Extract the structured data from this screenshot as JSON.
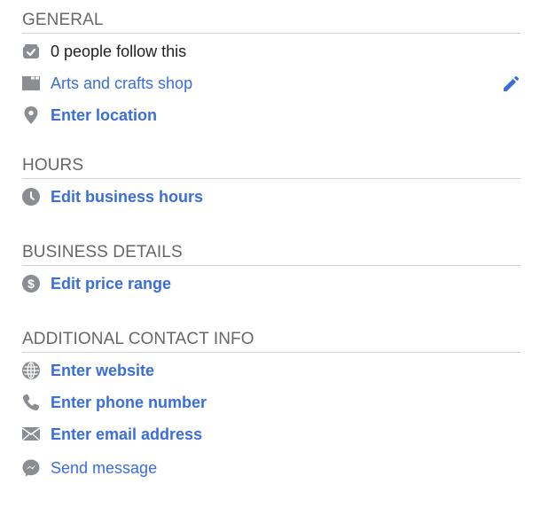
{
  "colors": {
    "accent": "#3a6ed8",
    "icon_gray": "#8a8d91",
    "heading_gray": "#65676b",
    "divider": "#cdd0d4",
    "text_dark": "#1c1e21"
  },
  "sections": {
    "general": {
      "title": "GENERAL",
      "followers": {
        "icon": "followers-check-icon",
        "text": "0 people follow this"
      },
      "category": {
        "icon": "category-icon",
        "text": "Arts and crafts shop",
        "edit_icon": "pencil-icon"
      },
      "location": {
        "icon": "location-pin-icon",
        "text": "Enter location"
      }
    },
    "hours": {
      "title": "HOURS",
      "edit_hours": {
        "icon": "clock-icon",
        "text": "Edit business hours"
      }
    },
    "business_details": {
      "title": "BUSINESS DETAILS",
      "price_range": {
        "icon": "dollar-icon",
        "text": "Edit price range"
      }
    },
    "additional_contact": {
      "title": "ADDITIONAL CONTACT INFO",
      "website": {
        "icon": "globe-icon",
        "text": "Enter website"
      },
      "phone": {
        "icon": "phone-icon",
        "text": "Enter phone number"
      },
      "email": {
        "icon": "envelope-icon",
        "text": "Enter email address"
      },
      "message": {
        "icon": "messenger-icon",
        "text": "Send message"
      }
    }
  }
}
